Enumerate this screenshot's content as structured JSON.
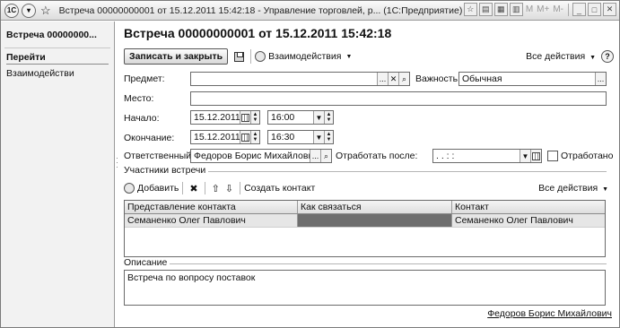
{
  "window": {
    "title": "Встреча 00000000001 от 15.12.2011 15:42:18 - Управление торговлей, р... (1С:Предприятие)",
    "app_icon": "1С",
    "mem_buttons": [
      "M",
      "M+",
      "M-"
    ],
    "icons": [
      "app-icon",
      "menu-icon",
      "star-icon",
      "bookmark-icon",
      "print-icon",
      "calculator-icon",
      "calendar-icon",
      "minimize-icon",
      "maximize-icon",
      "close-icon"
    ]
  },
  "sidebar": {
    "header": "Встреча 00000000...",
    "section_title": "Перейти",
    "items": [
      {
        "label": "Взаимодействи"
      }
    ]
  },
  "form": {
    "heading": "Встреча 00000000001 от 15.12.2011 15:42:18",
    "toolbar": {
      "save_close_label": "Записать и закрыть",
      "interactions_label": "Взаимодействия",
      "all_actions_label": "Все действия",
      "help_label": "?"
    },
    "subject": {
      "label": "Предмет:",
      "value": "",
      "button": "..."
    },
    "importance": {
      "label": "Важность:",
      "value": "Обычная",
      "button": "..."
    },
    "location": {
      "label": "Место:",
      "value": ""
    },
    "start": {
      "label": "Начало:",
      "date": "15.12.2011",
      "time": "16:00"
    },
    "end": {
      "label": "Окончание:",
      "date": "15.12.2011",
      "time": "16:30"
    },
    "responsible": {
      "label": "Ответственный:",
      "value": "Федоров Борис Михайлович",
      "button": "..."
    },
    "work_after": {
      "label": "Отработать после:",
      "value": ". .   : :"
    },
    "worked_off": {
      "label": "Отработано",
      "checked": false
    }
  },
  "participants": {
    "group_title": "Участники встречи",
    "toolbar": {
      "add_label": "Добавить",
      "create_contact_label": "Создать контакт",
      "all_actions_label": "Все действия"
    },
    "columns": [
      "Представление контакта",
      "Как связаться",
      "Контакт"
    ],
    "rows": [
      [
        "Семаненко Олег Павлович",
        "",
        "Семаненко Олег Павлович"
      ]
    ]
  },
  "description": {
    "group_title": "Описание",
    "text": "Встреча по вопросу поставок"
  },
  "footer": {
    "author_link": "Федоров Борис Михайлович"
  }
}
